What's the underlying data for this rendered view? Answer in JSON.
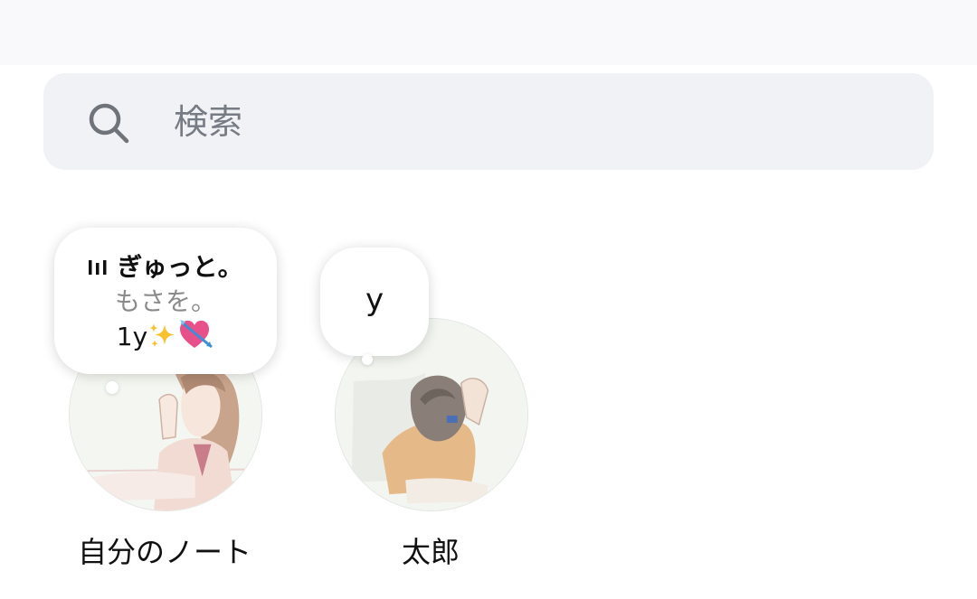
{
  "search": {
    "placeholder": "検索"
  },
  "notes": [
    {
      "bubble": {
        "title": "ぎゅっと。",
        "artist": "もさを。",
        "extra_prefix": "1y"
      },
      "label": "自分のノート"
    },
    {
      "bubble": {
        "text": "y"
      },
      "label": "太郎"
    }
  ]
}
